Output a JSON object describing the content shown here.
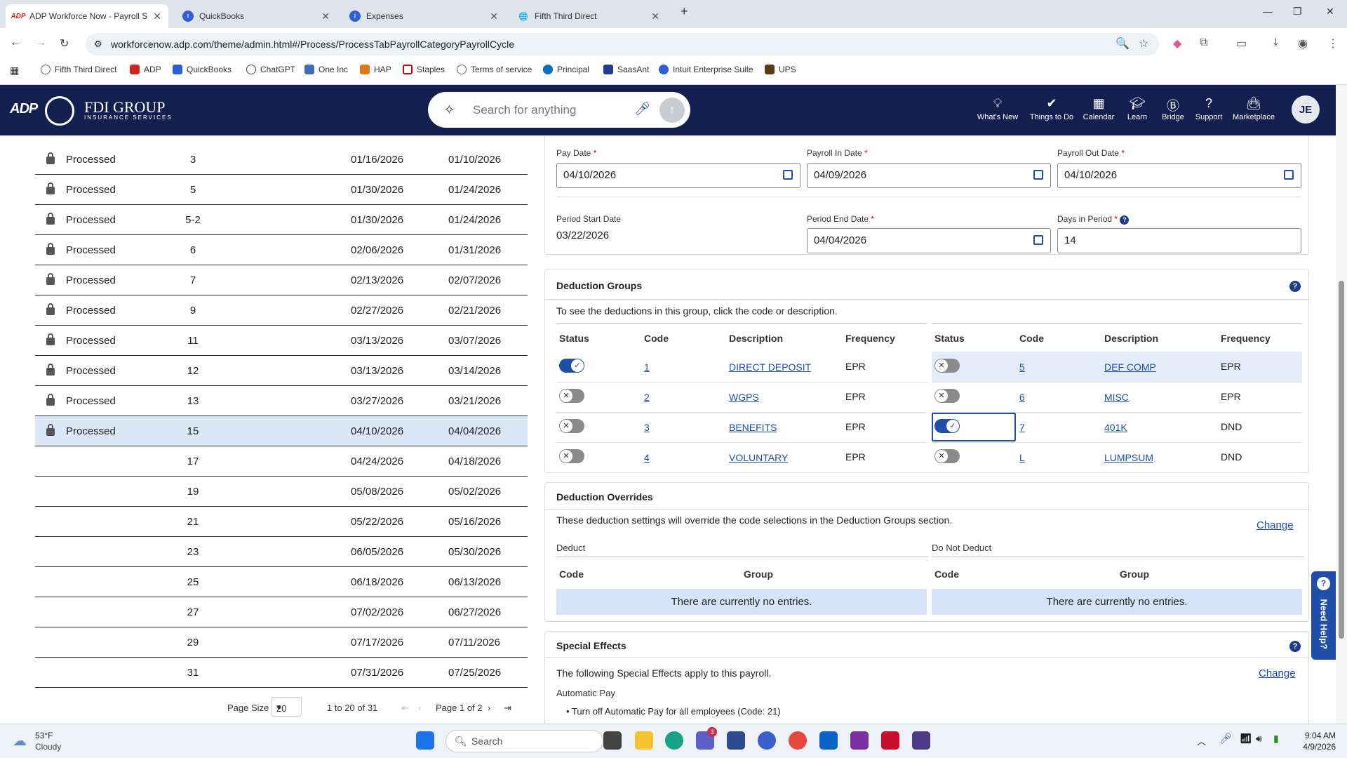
{
  "browser": {
    "tabs": [
      {
        "title": "ADP Workforce Now - Payroll S",
        "active": true
      },
      {
        "title": "QuickBooks",
        "active": false
      },
      {
        "title": "Expenses",
        "active": false
      },
      {
        "title": "Fifth Third Direct",
        "active": false
      }
    ],
    "url": "workforcenow.adp.com/theme/admin.html#/Process/ProcessTabPayrollCategoryPayrollCycle",
    "bookmarks": [
      "Fifth Third Direct",
      "ADP",
      "QuickBooks",
      "ChatGPT",
      "One Inc",
      "HAP",
      "Staples",
      "Terms of service",
      "Principal",
      "SaasAnt",
      "Intuit Enterprise Suite",
      "UPS"
    ]
  },
  "header": {
    "logo_adp": "ADP",
    "company": "FDI GROUP",
    "company_sub": "INSURANCE SERVICES",
    "search_placeholder": "Search for anything",
    "nav": [
      "What's New",
      "Things to Do",
      "Calendar",
      "Learn",
      "Bridge",
      "Support",
      "Marketplace"
    ],
    "avatar": "JE"
  },
  "cycles": [
    {
      "status": "Processed",
      "no": "3",
      "date1": "01/16/2026",
      "date2": "01/10/2026",
      "locked": true
    },
    {
      "status": "Processed",
      "no": "5",
      "date1": "01/30/2026",
      "date2": "01/24/2026",
      "locked": true
    },
    {
      "status": "Processed",
      "no": "5-2",
      "date1": "01/30/2026",
      "date2": "01/24/2026",
      "locked": true
    },
    {
      "status": "Processed",
      "no": "6",
      "date1": "02/06/2026",
      "date2": "01/31/2026",
      "locked": true
    },
    {
      "status": "Processed",
      "no": "7",
      "date1": "02/13/2026",
      "date2": "02/07/2026",
      "locked": true
    },
    {
      "status": "Processed",
      "no": "9",
      "date1": "02/27/2026",
      "date2": "02/21/2026",
      "locked": true
    },
    {
      "status": "Processed",
      "no": "11",
      "date1": "03/13/2026",
      "date2": "03/07/2026",
      "locked": true
    },
    {
      "status": "Processed",
      "no": "12",
      "date1": "03/13/2026",
      "date2": "03/14/2026",
      "locked": true
    },
    {
      "status": "Processed",
      "no": "13",
      "date1": "03/27/2026",
      "date2": "03/21/2026",
      "locked": true
    },
    {
      "status": "Processed",
      "no": "15",
      "date1": "04/10/2026",
      "date2": "04/04/2026",
      "locked": true,
      "selected": true
    },
    {
      "status": "",
      "no": "17",
      "date1": "04/24/2026",
      "date2": "04/18/2026",
      "locked": false
    },
    {
      "status": "",
      "no": "19",
      "date1": "05/08/2026",
      "date2": "05/02/2026",
      "locked": false
    },
    {
      "status": "",
      "no": "21",
      "date1": "05/22/2026",
      "date2": "05/16/2026",
      "locked": false
    },
    {
      "status": "",
      "no": "23",
      "date1": "06/05/2026",
      "date2": "05/30/2026",
      "locked": false
    },
    {
      "status": "",
      "no": "25",
      "date1": "06/18/2026",
      "date2": "06/13/2026",
      "locked": false
    },
    {
      "status": "",
      "no": "27",
      "date1": "07/02/2026",
      "date2": "06/27/2026",
      "locked": false
    },
    {
      "status": "",
      "no": "29",
      "date1": "07/17/2026",
      "date2": "07/11/2026",
      "locked": false
    },
    {
      "status": "",
      "no": "31",
      "date1": "07/31/2026",
      "date2": "07/25/2026",
      "locked": false
    }
  ],
  "pager": {
    "page_size_label": "Page Size",
    "page_size": "20",
    "range": "1 to 20 of 31",
    "page": "Page 1 of 2"
  },
  "dates": {
    "pay_date_label": "Pay Date",
    "pay_date": "04/10/2026",
    "payroll_in_label": "Payroll In Date",
    "payroll_in": "04/09/2026",
    "payroll_out_label": "Payroll Out Date",
    "payroll_out": "04/10/2026",
    "period_start_label": "Period Start Date",
    "period_start": "03/22/2026",
    "period_end_label": "Period End Date",
    "period_end": "04/04/2026",
    "days_label": "Days in Period",
    "days": "14",
    "required_mark": "*"
  },
  "deduction_groups": {
    "title": "Deduction Groups",
    "hint": "To see the deductions in this group, click the code or description.",
    "headers": [
      "Status",
      "Code",
      "Description",
      "Frequency"
    ],
    "left": [
      {
        "on": true,
        "code": "1",
        "desc": "DIRECT DEPOSIT",
        "freq": "EPR"
      },
      {
        "on": false,
        "code": "2",
        "desc": "WGPS",
        "freq": "EPR"
      },
      {
        "on": false,
        "code": "3",
        "desc": "BENEFITS",
        "freq": "EPR"
      },
      {
        "on": false,
        "code": "4",
        "desc": "VOLUNTARY",
        "freq": "EPR"
      }
    ],
    "right": [
      {
        "on": false,
        "code": "5",
        "desc": "DEF COMP",
        "freq": "EPR"
      },
      {
        "on": false,
        "code": "6",
        "desc": "MISC",
        "freq": "EPR"
      },
      {
        "on": true,
        "code": "7",
        "desc": "401K",
        "freq": "DND"
      },
      {
        "on": false,
        "code": "L",
        "desc": "LUMPSUM",
        "freq": "DND"
      }
    ]
  },
  "deduction_overrides": {
    "title": "Deduction Overrides",
    "text": "These deduction settings will override the code selections in the Deduction Groups section.",
    "change": "Change",
    "deduct": "Deduct",
    "do_not_deduct": "Do Not Deduct",
    "col_code": "Code",
    "col_group": "Group",
    "empty": "There are currently no entries."
  },
  "special_effects": {
    "title": "Special Effects",
    "text": "The following Special Effects apply to this payroll.",
    "change": "Change",
    "auto_pay": "Automatic Pay",
    "bullet": "Turn off Automatic Pay for all employees (Code: 21)"
  },
  "need_help": "Need Help?",
  "taskbar": {
    "weather_temp": "53°F",
    "weather_desc": "Cloudy",
    "search": "Search",
    "time": "9:04 AM",
    "date": "4/9/2026",
    "teams_badge": "3"
  }
}
